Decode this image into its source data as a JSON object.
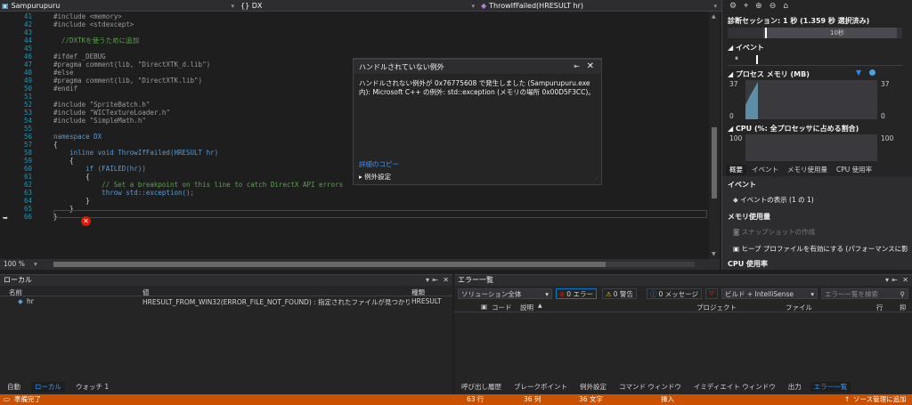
{
  "nav": {
    "project": "Sampurupuru",
    "scope": "{} DX",
    "member": "ThrowIfFailed(HRESULT hr)"
  },
  "code_lines": [
    {
      "n": "41",
      "t": "#include <memory>",
      "c": "c-gray"
    },
    {
      "n": "42",
      "t": "#include <stdexcept>",
      "c": "c-gray"
    },
    {
      "n": "43",
      "t": "",
      "c": "c-gray"
    },
    {
      "n": "44",
      "t": "  //DXTKを使うために追加",
      "c": "c-green"
    },
    {
      "n": "45",
      "t": "",
      "c": "c-gray"
    },
    {
      "n": "46",
      "t": "#ifdef _DEBUG",
      "c": "c-gray"
    },
    {
      "n": "47",
      "t": "#pragma comment(lib, \"DirectXTK_d.lib\")",
      "c": "c-gray"
    },
    {
      "n": "48",
      "t": "#else",
      "c": "c-gray"
    },
    {
      "n": "49",
      "t": "#pragma comment(lib, \"DirectXTK.lib\")",
      "c": "c-gray"
    },
    {
      "n": "50",
      "t": "#endif",
      "c": "c-gray"
    },
    {
      "n": "51",
      "t": "",
      "c": "c-gray"
    },
    {
      "n": "52",
      "t": "#include \"SpriteBatch.h\"",
      "c": "c-gray"
    },
    {
      "n": "53",
      "t": "#include \"WICTextureLoader.h\"",
      "c": "c-gray"
    },
    {
      "n": "54",
      "t": "#include \"SimpleMath.h\"",
      "c": "c-gray"
    },
    {
      "n": "55",
      "t": "",
      "c": "c-gray"
    },
    {
      "n": "56",
      "t": "namespace DX",
      "c": "c-blue"
    },
    {
      "n": "57",
      "t": "{",
      "c": "c-white"
    },
    {
      "n": "58",
      "t": "    inline void ThrowIfFailed(HRESULT hr)",
      "c": "c-blue"
    },
    {
      "n": "59",
      "t": "    {",
      "c": "c-white"
    },
    {
      "n": "60",
      "t": "        if (FAILED(hr))",
      "c": "c-blue"
    },
    {
      "n": "61",
      "t": "        {",
      "c": "c-white"
    },
    {
      "n": "62",
      "t": "            // Set a breakpoint on this line to catch DirectX API errors",
      "c": "c-green"
    },
    {
      "n": "63",
      "t": "            throw std::exception();",
      "c": "c-blue"
    },
    {
      "n": "64",
      "t": "        }",
      "c": "c-white"
    },
    {
      "n": "65",
      "t": "    }",
      "c": "c-white"
    },
    {
      "n": "66",
      "t": "}",
      "c": "c-white"
    }
  ],
  "zoom": "100 %",
  "popup": {
    "title": "ハンドルされていない例外",
    "message": "ハンドルされない例外が 0x76775608 で発生しました (Sampurupuru.exe 内): Microsoft C++ の例外: std::exception (メモリの場所 0x00D5F3CC)。",
    "copy_details": "詳細のコピー",
    "exception_settings": "例外設定"
  },
  "diag": {
    "session": "診断セッション: 1 秒 (1.359 秒 選択済み)",
    "timeline_label": "10秒",
    "events_header": "イベント",
    "memory_header": "プロセス メモリ (MB)",
    "mem_max_left": "37",
    "mem_max_right": "37",
    "mem_min_left": "0",
    "mem_min_right": "0",
    "cpu_header": "CPU (%: 全プロセッサに占める割合)",
    "cpu_max_left": "100",
    "cpu_max_right": "100",
    "tabs": [
      "概要",
      "イベント",
      "メモリ使用量",
      "CPU 使用率"
    ],
    "sec_events": "イベント",
    "show_events": "イベントの表示 (1 の 1)",
    "sec_memory": "メモリ使用量",
    "snapshot": "スナップショットの作成",
    "heap_profile": "ヒープ プロファイルを有効にする (パフォーマンスに影",
    "sec_cpu": "CPU 使用率"
  },
  "locals": {
    "title": "ローカル",
    "col_name": "名前",
    "col_value": "値",
    "col_type": "種類",
    "row_name": "hr",
    "row_value": "HRESULT_FROM_WIN32(ERROR_FILE_NOT_FOUND) : 指定されたファイルが見つかりませ",
    "row_type": "HRESULT",
    "tabs": [
      "自動",
      "ローカル",
      "ウォッチ 1"
    ]
  },
  "errors": {
    "title": "エラー一覧",
    "scope": "ソリューション全体",
    "err_count": "0 エラー",
    "warn_count": "0 警告",
    "msg_count": "0 メッセージ",
    "build_filter": "ビルド + IntelliSense",
    "search_placeholder": "エラー一覧を検索",
    "col_code": "コード",
    "col_desc": "説明",
    "col_project": "プロジェクト",
    "col_file": "ファイル",
    "col_line": "行",
    "col_suppress": "抑",
    "tabs": [
      "呼び出し履歴",
      "ブレークポイント",
      "例外設定",
      "コマンド ウィンドウ",
      "イミディエイト ウィンドウ",
      "出力",
      "エラー一覧"
    ]
  },
  "status": {
    "ready": "準備完了",
    "line": "63 行",
    "col": "36 列",
    "chars": "36 文字",
    "mode": "挿入",
    "scm": "ソース管理に追加"
  },
  "colors": {
    "status_bar": "#ca5100",
    "accent": "#007acc",
    "error": "#e51400"
  }
}
